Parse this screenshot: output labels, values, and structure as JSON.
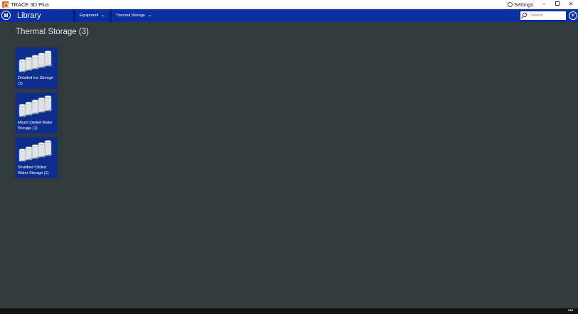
{
  "window": {
    "title": "TRACE 3D Plus",
    "settings_label": "Settings",
    "minimize_glyph": "–",
    "close_glyph": "✕"
  },
  "appbar": {
    "title": "Library",
    "breadcrumbs": [
      {
        "label": "Equipment"
      },
      {
        "label": "Thermal Storage"
      }
    ],
    "search_placeholder": "Search",
    "close_glyph": "✕"
  },
  "main": {
    "page_title": "Thermal Storage (3)",
    "tiles": [
      {
        "label": "Detailed Ice Storage (1)",
        "image_icon": "storage-tanks-icon"
      },
      {
        "label": "Mixed Chilled Water Storage (1)",
        "image_icon": "storage-tanks-icon"
      },
      {
        "label": "Stratified Chilled Water Storage (1)",
        "image_icon": "storage-tanks-icon"
      }
    ]
  },
  "bottombar": {
    "more_glyph": "•••"
  },
  "colors": {
    "appbar": "#0b2ea3",
    "content_bg": "#323a3e",
    "tile_bg": "#0e2e8d",
    "bottombar": "#121212"
  }
}
